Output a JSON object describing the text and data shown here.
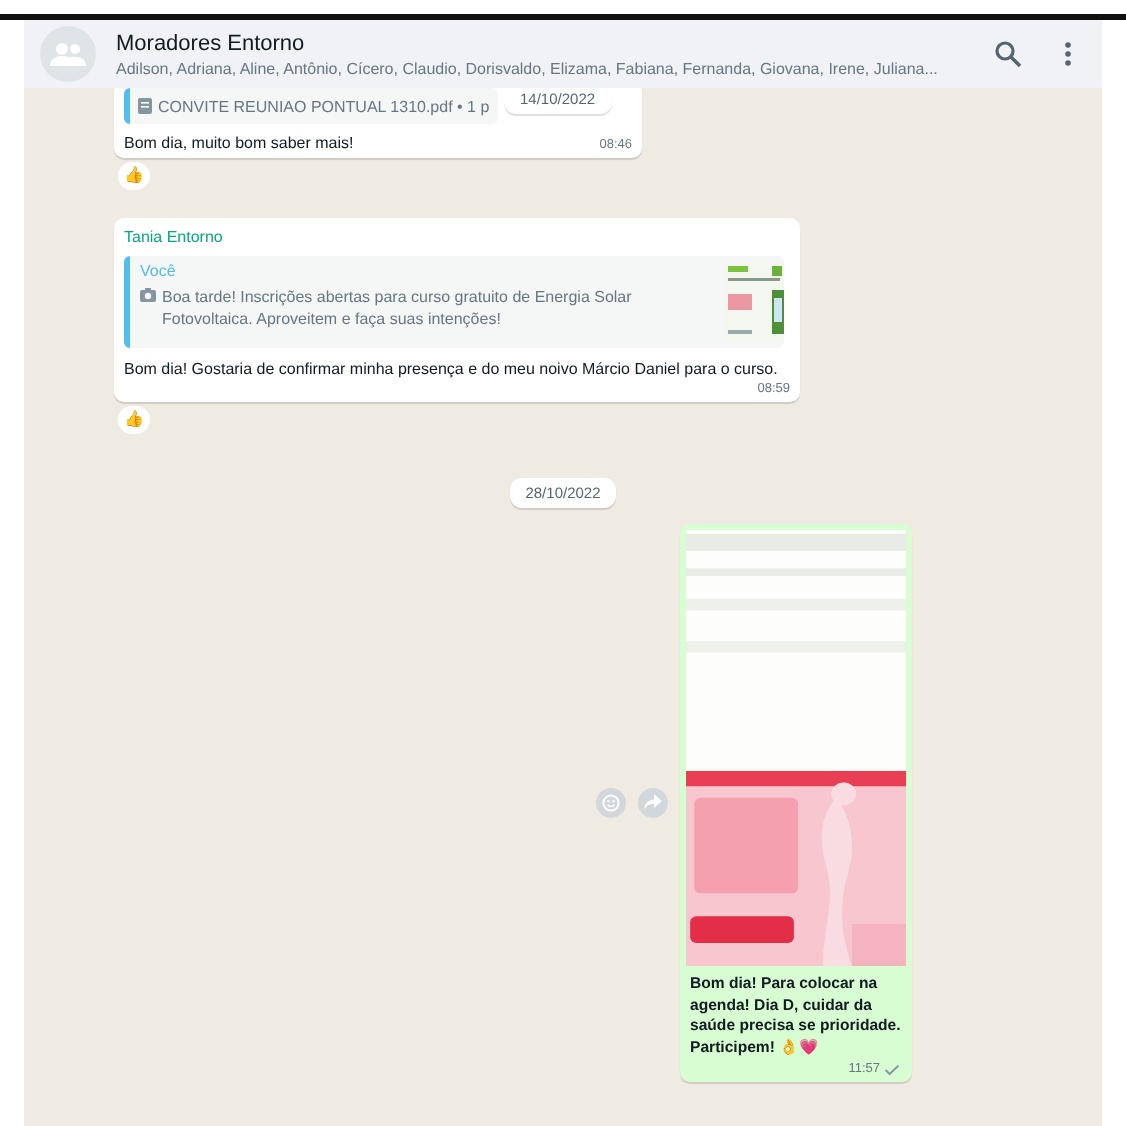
{
  "header": {
    "title": "Moradores Entorno",
    "members": "Adilson, Adriana, Aline, Antônio, Cícero, Claudio, Dorisvaldo, Elizama, Fabiana, Fernanda, Giovana, Irene, Juliana..."
  },
  "floating_date": "14/10/2022",
  "messages": [
    {
      "kind": "document",
      "document": "CONVITE REUNIAO PONTUAL 1310.pdf • 1 p",
      "text": "Bom dia, muito bom saber mais!",
      "time": "08:46",
      "reaction": "👍"
    },
    {
      "kind": "reply",
      "sender": "Tania Entorno",
      "quote_author": "Você",
      "quote_text": "Boa tarde! Inscrições abertas para curso gratuito de Energia Solar Fotovoltaica. Aproveitem e faça suas intenções!",
      "text": "Bom dia! Gostaria de confirmar minha presença e do meu noivo Márcio Daniel para o curso.",
      "time": "08:59",
      "reaction": "👍"
    },
    {
      "kind": "date",
      "text": "28/10/2022"
    },
    {
      "text": "Bom dia! Para colocar na agenda! Dia D, cuidar da saúde precisa se prioridade. Participem! 👌💗",
      "time": "11:57"
    }
  ]
}
